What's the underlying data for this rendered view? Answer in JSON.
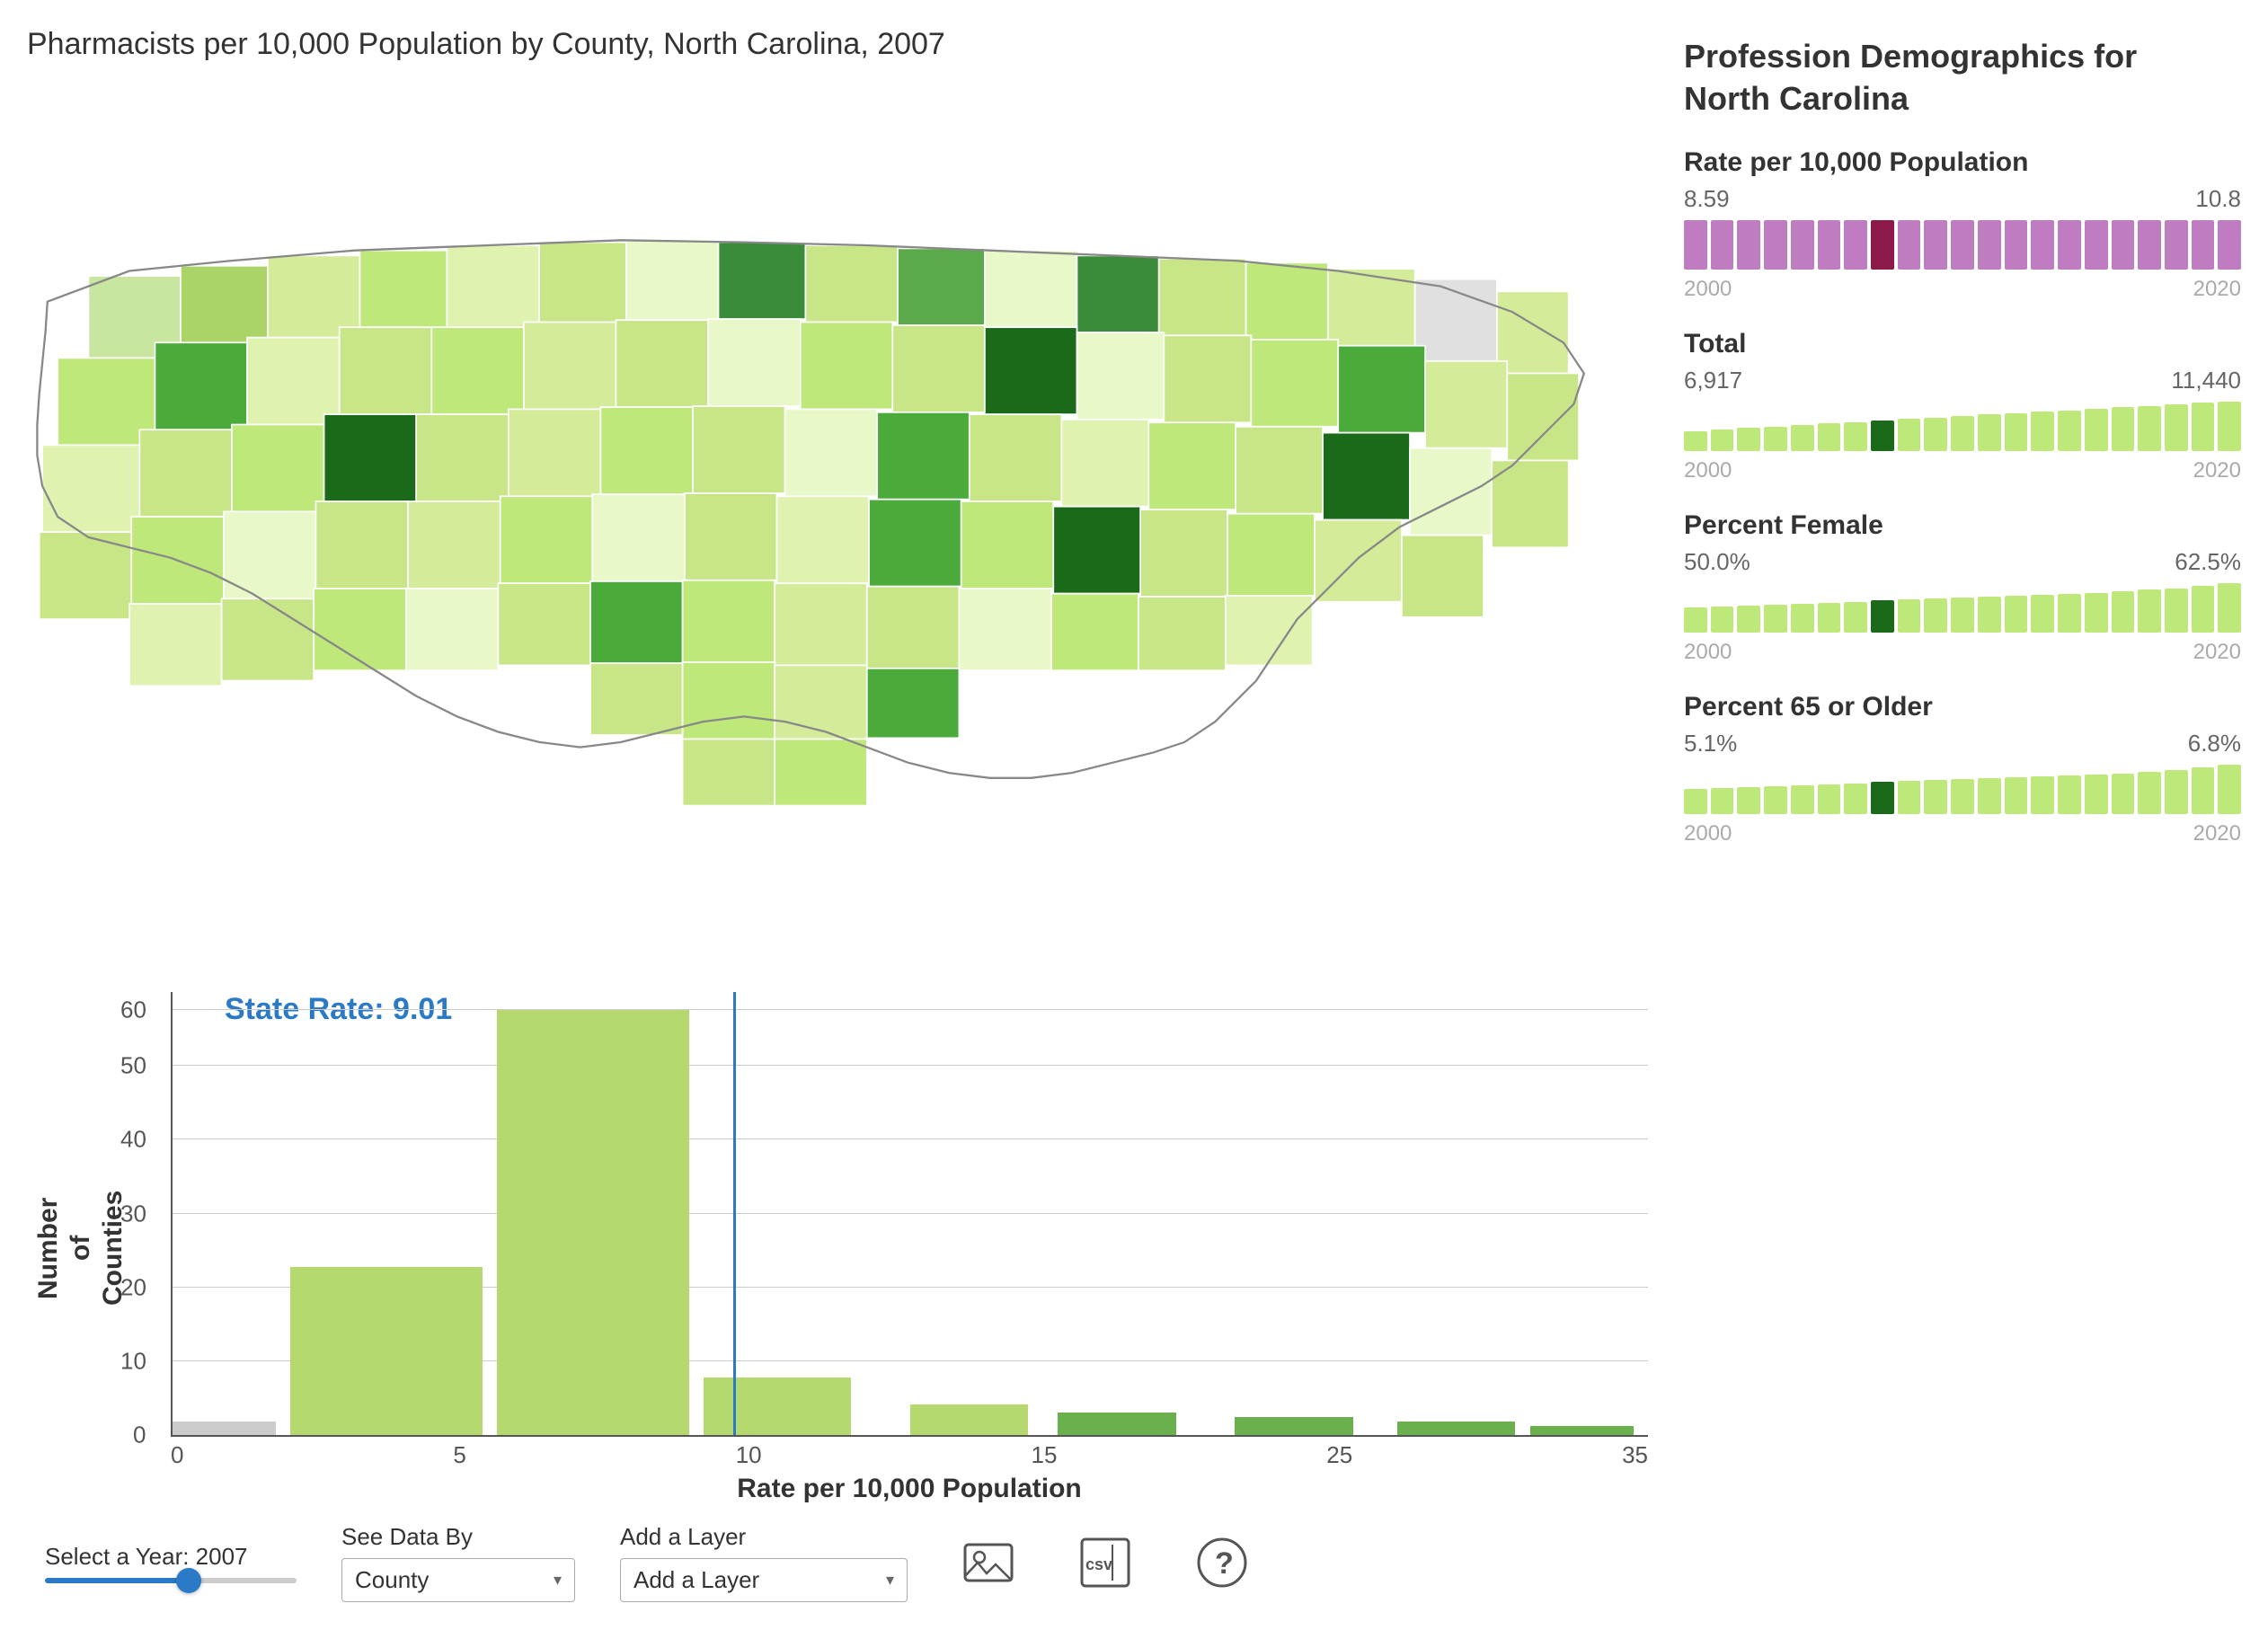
{
  "title": "Pharmacists per 10,000 Population by County, North Carolina, 2007",
  "right_panel": {
    "title": "Profession Demographics for\nNorth Carolina",
    "metrics": [
      {
        "id": "rate",
        "label": "Rate per 10,000 Population",
        "min_val": "8.59",
        "max_val": "10.8",
        "year_start": "2000",
        "year_end": "2020",
        "bar_colors": [
          "purple",
          "purple",
          "purple",
          "purple",
          "purple",
          "purple",
          "purple",
          "darkred",
          "purple",
          "purple",
          "purple",
          "purple",
          "purple",
          "purple",
          "purple",
          "purple",
          "purple",
          "purple",
          "purple",
          "purple",
          "purple"
        ],
        "bar_type": "purple"
      },
      {
        "id": "total",
        "label": "Total",
        "min_val": "6,917",
        "max_val": "11,440",
        "year_start": "2000",
        "year_end": "2020",
        "bar_type": "green"
      },
      {
        "id": "pct_female",
        "label": "Percent Female",
        "min_val": "50.0%",
        "max_val": "62.5%",
        "year_start": "2000",
        "year_end": "2020",
        "bar_type": "green"
      },
      {
        "id": "pct_65",
        "label": "Percent 65 or Older",
        "min_val": "5.1%",
        "max_val": "6.8%",
        "year_start": "2000",
        "year_end": "2020",
        "bar_type": "green"
      }
    ]
  },
  "histogram": {
    "state_rate_label": "State Rate: 9.01",
    "y_label": "Number\nof\nCounties",
    "x_label": "Rate per 10,000 Population",
    "y_ticks": [
      "0",
      "10",
      "20",
      "30",
      "40",
      "50",
      "60"
    ],
    "x_ticks": [
      "0",
      "5",
      "10",
      "15",
      "25",
      "35"
    ],
    "bars": [
      {
        "x_pct": 8,
        "width_pct": 14,
        "height_pct": 38,
        "dark": false
      },
      {
        "x_pct": 23,
        "width_pct": 14,
        "height_pct": 97,
        "dark": false
      },
      {
        "x_pct": 38,
        "width_pct": 14,
        "height_pct": 13,
        "dark": false
      },
      {
        "x_pct": 52,
        "width_pct": 7,
        "height_pct": 6,
        "dark": false
      },
      {
        "x_pct": 59,
        "width_pct": 7,
        "height_pct": 5,
        "dark": false
      },
      {
        "x_pct": 66,
        "width_pct": 7,
        "height_pct": 4,
        "dark": true
      },
      {
        "x_pct": 80,
        "width_pct": 7,
        "height_pct": 3,
        "dark": true
      },
      {
        "x_pct": 92,
        "width_pct": 7,
        "height_pct": 2,
        "dark": true
      }
    ],
    "state_rate_x_pct": 38
  },
  "controls": {
    "year_label": "Select a Year: 2007",
    "see_data_by_label": "See Data By",
    "see_data_by_value": "County",
    "add_layer_label": "Add a Layer",
    "add_layer_value": "Add a Layer"
  }
}
